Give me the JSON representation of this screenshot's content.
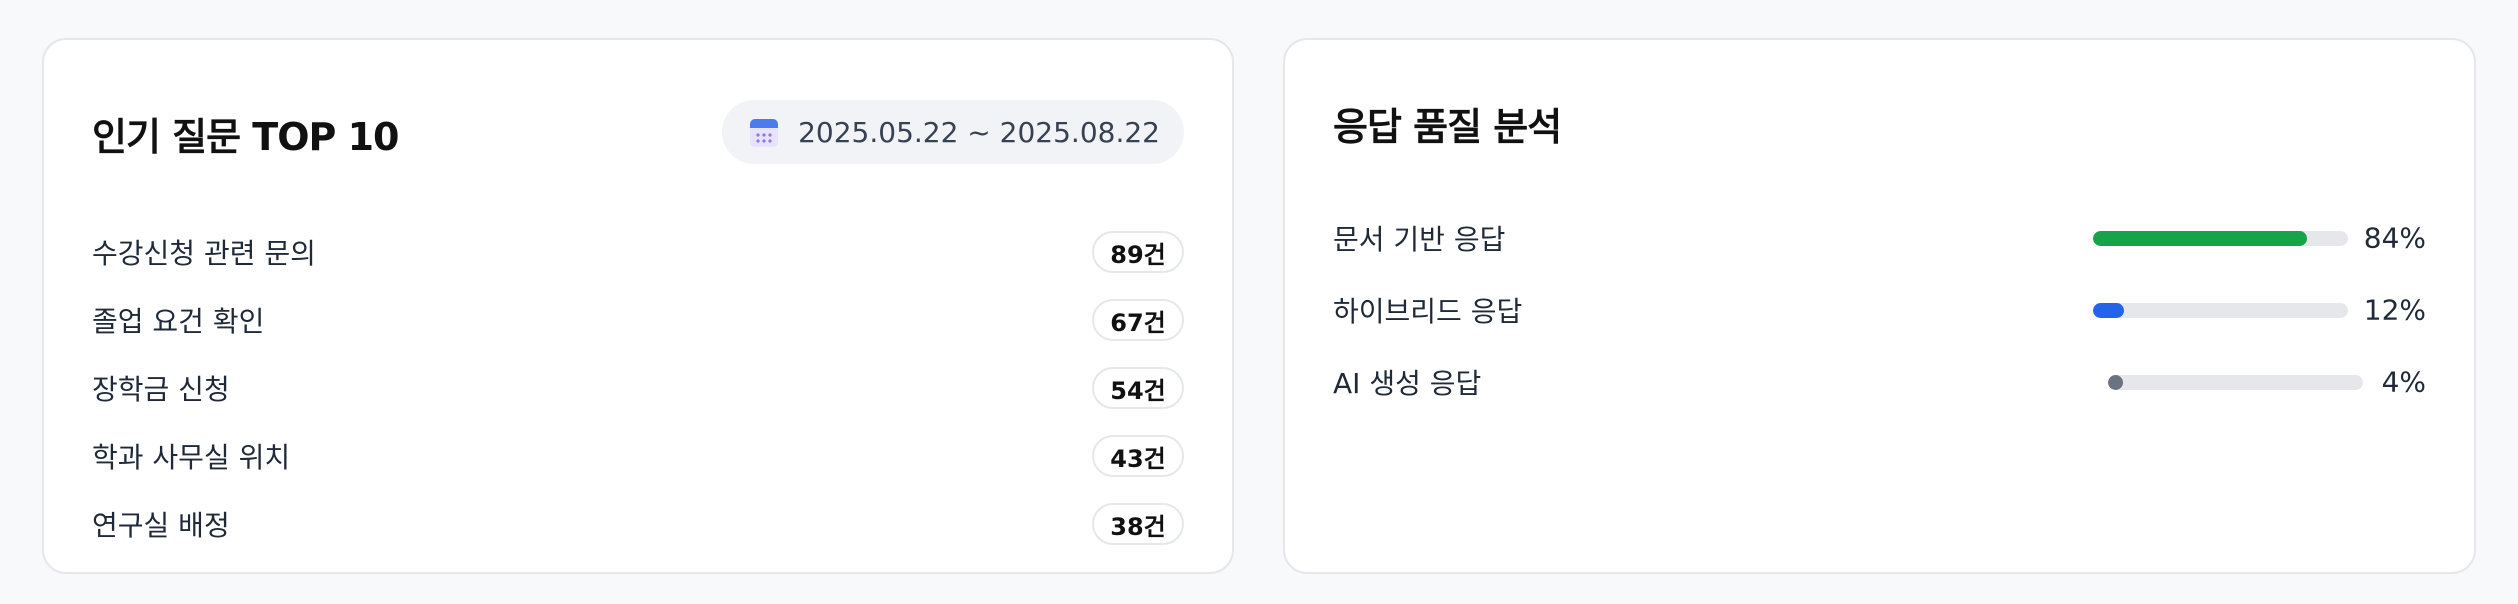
{
  "popular": {
    "title": "인기 질문 TOP 10",
    "date_range": "2025.05.22 ~ 2025.08.22",
    "items": [
      {
        "label": "수강신청 관련 문의",
        "count": "89건"
      },
      {
        "label": "졸업 요건 확인",
        "count": "67건"
      },
      {
        "label": "장학금 신청",
        "count": "54건"
      },
      {
        "label": "학과 사무실 위치",
        "count": "43건"
      },
      {
        "label": "연구실 배정",
        "count": "38건"
      }
    ]
  },
  "quality": {
    "title": "응답 품질 분석",
    "items": [
      {
        "label": "문서 기반 응답",
        "percent_label": "84%",
        "value": 84,
        "color": "#16a34a"
      },
      {
        "label": "하이브리드 응답",
        "percent_label": "12%",
        "value": 12,
        "color": "#2563eb"
      },
      {
        "label": "AI 생성 응답",
        "percent_label": "4%",
        "value": 4,
        "color": "#6b7280"
      }
    ]
  },
  "icons": {
    "date_pill": "calendar-icon"
  }
}
